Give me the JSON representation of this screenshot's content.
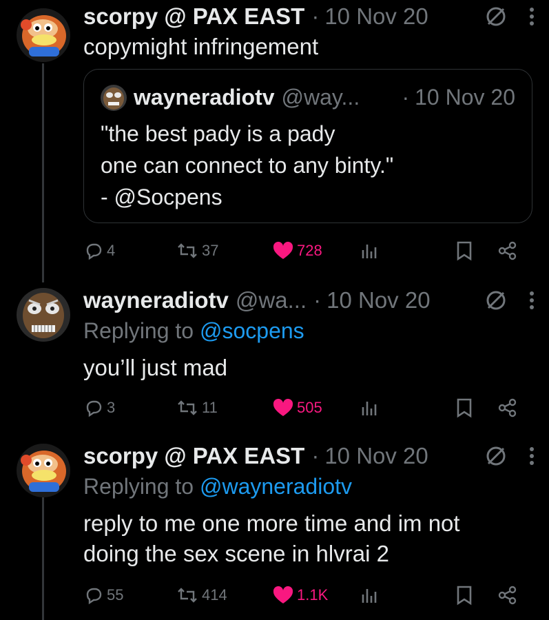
{
  "tweets": [
    {
      "name": "scorpy @ PAX EAST",
      "handle": "",
      "time": "10 Nov 20",
      "text": "copymight infringement",
      "quote": {
        "name": "wayneradiotv",
        "handle": "@way...",
        "time": "10 Nov 20",
        "text": "\"the best pady is a pady\none can connect to any binty.\"\n- @Socpens"
      },
      "replies": "4",
      "retweets": "37",
      "likes": "728"
    },
    {
      "name": "wayneradiotv",
      "handle": "@wa...",
      "time": "10 Nov 20",
      "reply_prefix": "Replying to",
      "reply_to": "@socpens",
      "text": "you’ll just mad",
      "replies": "3",
      "retweets": "11",
      "likes": "505"
    },
    {
      "name": "scorpy @ PAX EAST",
      "handle": "",
      "time": "10 Nov 20",
      "reply_prefix": "Replying to",
      "reply_to": "@wayneradiotv",
      "text": "reply to me one more time and im not\ndoing the sex scene in hlvrai 2",
      "replies": "55",
      "retweets": "414",
      "likes": "1.1K"
    }
  ],
  "separator": "·",
  "colors": {
    "background": "#000000",
    "text": "#e7e9ea",
    "muted": "#71767b",
    "link": "#1d9bf0",
    "like": "#f91880",
    "border": "#2f3336"
  },
  "icons": [
    "reply-icon",
    "retweet-icon",
    "heart-icon",
    "analytics-icon",
    "bookmark-icon",
    "share-icon",
    "ghost-icon",
    "more-icon"
  ]
}
